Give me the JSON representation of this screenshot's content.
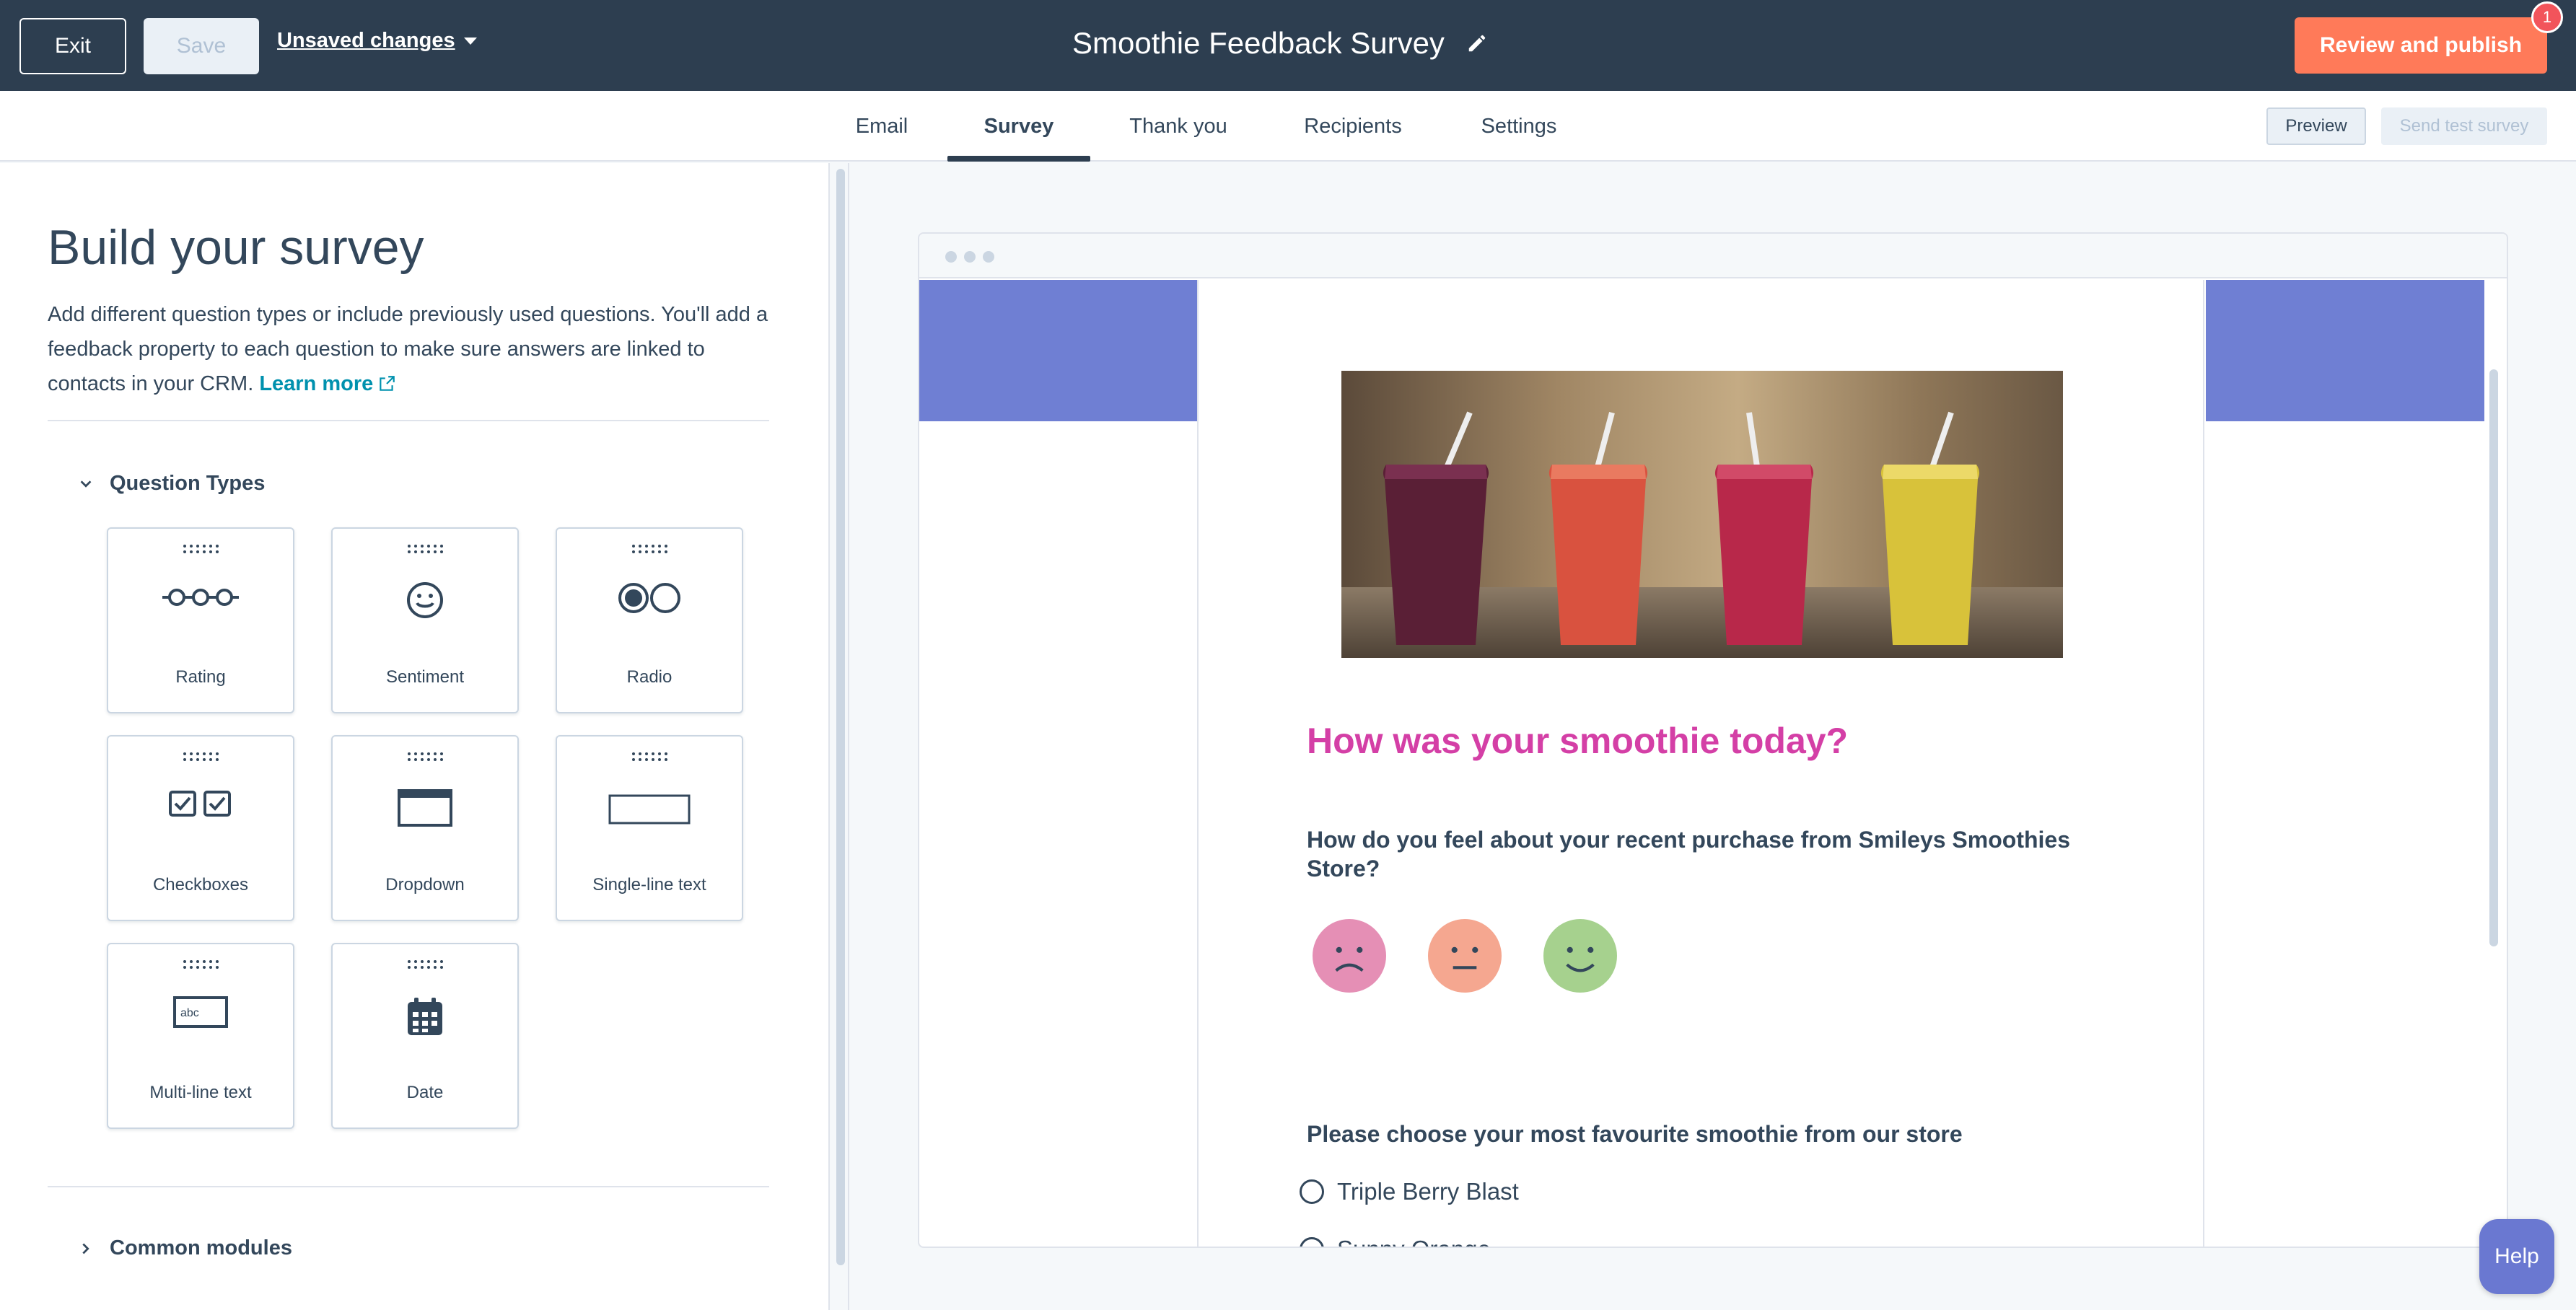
{
  "topbar": {
    "exit_label": "Exit",
    "save_label": "Save",
    "unsaved_label": "Unsaved changes",
    "survey_title": "Smoothie Feedback Survey",
    "publish_label": "Review and publish",
    "notification_count": "1"
  },
  "tabs": [
    {
      "label": "Email",
      "active": false
    },
    {
      "label": "Survey",
      "active": true
    },
    {
      "label": "Thank you",
      "active": false
    },
    {
      "label": "Recipients",
      "active": false
    },
    {
      "label": "Settings",
      "active": false
    }
  ],
  "tabbar_actions": {
    "preview_label": "Preview",
    "send_test_label": "Send test survey"
  },
  "left_panel": {
    "title": "Build your survey",
    "description": "Add different question types or include previously used questions. You'll add a feedback property to each question to make sure answers are linked to contacts in your CRM.",
    "learn_more": "Learn more",
    "section_question_types": "Question Types",
    "question_types": [
      {
        "label": "Rating",
        "icon": "rating-icon"
      },
      {
        "label": "Sentiment",
        "icon": "smiley-icon"
      },
      {
        "label": "Radio",
        "icon": "radio-icon"
      },
      {
        "label": "Checkboxes",
        "icon": "checkboxes-icon"
      },
      {
        "label": "Dropdown",
        "icon": "dropdown-icon"
      },
      {
        "label": "Single-line text",
        "icon": "single-line-text-icon"
      },
      {
        "label": "Multi-line text",
        "icon": "multi-line-text-icon"
      },
      {
        "label": "Date",
        "icon": "calendar-icon"
      }
    ],
    "multi_line_icon_text": "abc",
    "section_common_modules": "Common modules"
  },
  "preview": {
    "band_color": "#6f7fd3",
    "heading": "How was your smoothie today?",
    "heading_color": "#d43fa6",
    "question_1": "How do you feel about your recent purchase from Smileys Smoothies Store?",
    "sentiments": [
      {
        "name": "sad-face-icon",
        "color": "#e58fb5"
      },
      {
        "name": "neutral-face-icon",
        "color": "#f5a790"
      },
      {
        "name": "happy-face-icon",
        "color": "#a6d18e"
      }
    ],
    "question_2": "Please choose your most favourite smoothie from our store",
    "options": [
      "Triple Berry Blast",
      "Sunny Orange"
    ]
  },
  "help_label": "Help",
  "colors": {
    "topbar": "#2d3e50",
    "publish": "#ff7a59",
    "link": "#0091ae"
  }
}
